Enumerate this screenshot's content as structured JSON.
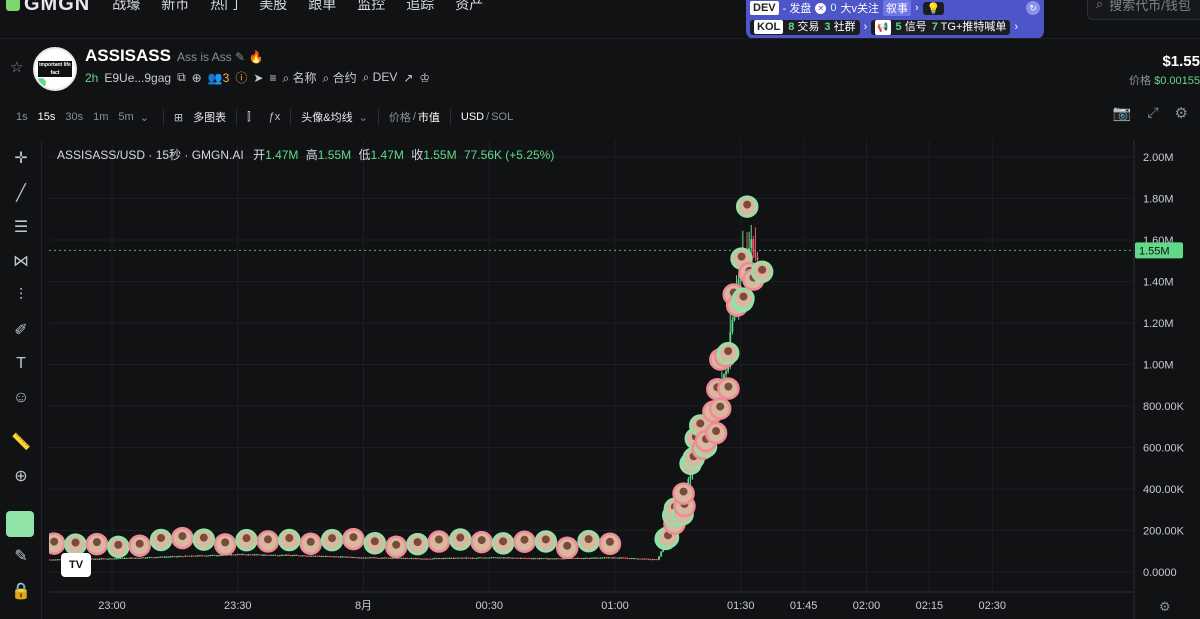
{
  "app": {
    "logo_text": "GMGN"
  },
  "nav": [
    "战壕",
    "新币",
    "热门",
    "美股",
    "跟单",
    "监控",
    "追踪",
    "资产"
  ],
  "search": {
    "placeholder": "搜索代币/钱包"
  },
  "panel": {
    "dev_label": "DEV",
    "dev_text": "- 发盘",
    "kol_count": "0",
    "kol_text": "大v关注",
    "narrative": "叙事",
    "kol_label": "KOL",
    "trades": "8",
    "trades_text": "交易",
    "community": "3",
    "community_text": "社群",
    "signals": "5",
    "signals_text": "信号",
    "tg_count": "7",
    "tg_text": "TG+推特喊单"
  },
  "token": {
    "name": "ASSISASS",
    "subtitle": "Ass is Ass",
    "age": "2h",
    "address": "E9Ue...9gag",
    "holders_count": "3",
    "search_name": "名称",
    "search_contract": "合约",
    "search_dev": "DEV",
    "avatar_text": "important life fact"
  },
  "price": {
    "value": "$1.55",
    "label": "价格",
    "sol_value": "$0.00155"
  },
  "toolbar": {
    "timeframes": [
      "1s",
      "15s",
      "30s",
      "1m",
      "5m"
    ],
    "active_timeframe": "15s",
    "multi_chart": "多图表",
    "avatar_ma": "头像&均线",
    "price_label": "价格",
    "mcap_label": "市值",
    "usd_label": "USD",
    "sol_label": "SOL"
  },
  "legend": {
    "pair": "ASSISASS/USD · 15秒 · GMGN.AI",
    "open_label": "开",
    "open": "1.47M",
    "high_label": "高",
    "high": "1.55M",
    "low_label": "低",
    "low": "1.47M",
    "close_label": "收",
    "close": "1.55M",
    "change": "77.56K (+5.25%)"
  },
  "tv_logo": "TV",
  "chart_data": {
    "type": "line",
    "title": "ASSISASS/USD · 15秒 · GMGN.AI",
    "y_ticks": [
      "2.00M",
      "1.80M",
      "1.60M",
      "1.40M",
      "1.20M",
      "1.00M",
      "800.00K",
      "600.00K",
      "400.00K",
      "200.00K",
      "0.0000"
    ],
    "x_ticks": [
      "23:00",
      "23:30",
      "8月",
      "00:30",
      "01:00",
      "01:30",
      "01:45",
      "02:00",
      "02:15",
      "02:30"
    ],
    "current_price_label": "1.55M",
    "ylim": [
      0,
      2000000
    ],
    "grid": true,
    "x": [
      "22:45",
      "23:00",
      "23:15",
      "23:30",
      "23:45",
      "00:00",
      "00:15",
      "00:30",
      "00:45",
      "01:00",
      "01:10",
      "01:15",
      "01:18",
      "01:20",
      "01:22",
      "01:25",
      "01:27",
      "01:28",
      "01:30",
      "01:32",
      "01:33",
      "01:34"
    ],
    "series": [
      {
        "values": [
          60000,
          65000,
          75000,
          85000,
          80000,
          70000,
          65000,
          70000,
          65000,
          70000,
          60000,
          290000,
          470000,
          620000,
          720000,
          860000,
          1050000,
          1300000,
          1450000,
          1520000,
          1600000,
          1550000
        ]
      }
    ],
    "x_positions_ref": [
      22.75,
      23.0,
      23.25,
      23.5,
      23.75,
      24.0,
      24.25,
      24.5,
      24.75,
      25.0,
      25.17,
      25.25,
      25.3,
      25.33,
      25.37,
      25.42,
      25.45,
      25.47,
      25.5,
      25.53,
      25.55,
      25.57
    ],
    "current_price": 1550000
  },
  "colors": {
    "up": "#62d98a",
    "down": "#ef5b6b",
    "panel": "#4d55c8",
    "accent": "#8fe3a7"
  }
}
